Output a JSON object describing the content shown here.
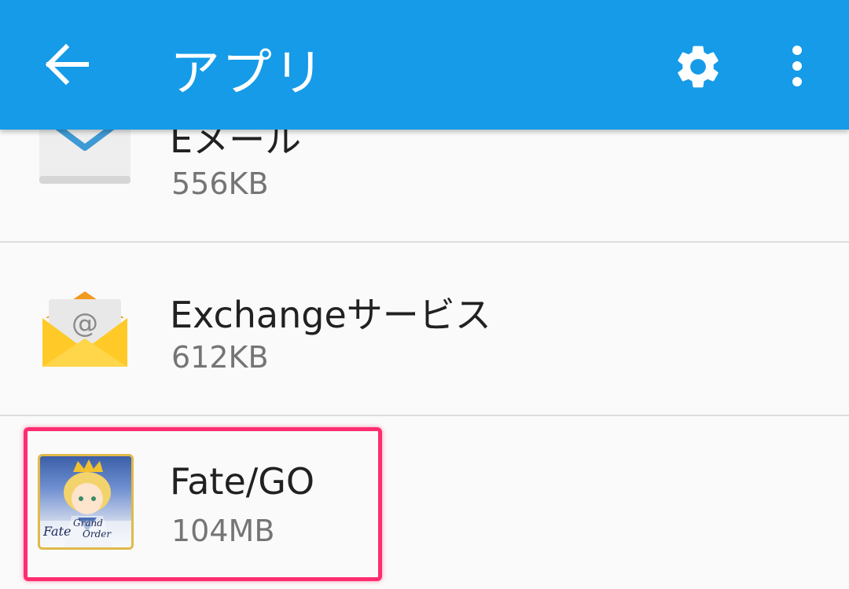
{
  "app_bar": {
    "title": "アプリ",
    "color": "#159be8",
    "back_icon": "arrow-left-icon",
    "settings_icon": "gear-icon",
    "more_icon": "more-vert-icon"
  },
  "apps": [
    {
      "name": "Eメール",
      "size": "556KB",
      "icon": "email-envelope-icon"
    },
    {
      "name": "Exchangeサービス",
      "size": "612KB",
      "icon": "exchange-mail-icon"
    },
    {
      "name": "Fate/GO",
      "size": "104MB",
      "icon": "fate-grand-order-icon"
    }
  ],
  "highlight": {
    "target": "Fate/GO",
    "color": "#ff2d6f"
  }
}
